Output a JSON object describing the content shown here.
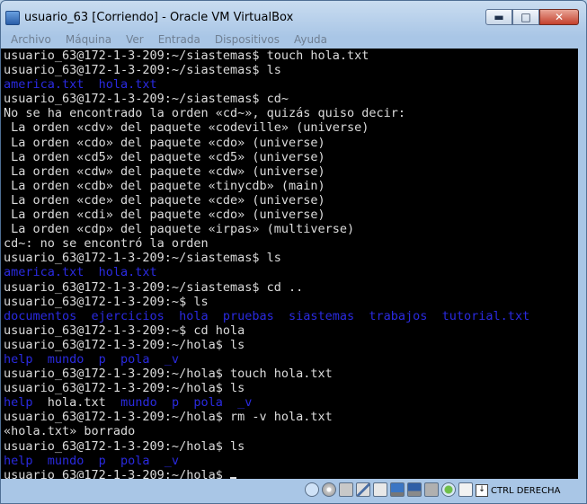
{
  "window": {
    "title": "usuario_63 [Corriendo] - Oracle VM VirtualBox"
  },
  "window_buttons": {
    "minimize": "▬",
    "maximize": "□",
    "close": "✕"
  },
  "menu": [
    "Archivo",
    "Máquina",
    "Ver",
    "Entrada",
    "Dispositivos",
    "Ayuda"
  ],
  "terminal": {
    "lines": [
      {
        "text": "usuario_63@172-1-3-209:~/siastemas$ touch hola.txt",
        "style": "normal"
      },
      {
        "text": "usuario_63@172-1-3-209:~/siastemas$ ls",
        "style": "normal"
      },
      {
        "text": "america.txt  hola.txt",
        "style": "blue"
      },
      {
        "text": "usuario_63@172-1-3-209:~/siastemas$ cd~",
        "style": "normal"
      },
      {
        "text": "No se ha encontrado la orden «cd~», quizás quiso decir:",
        "style": "normal"
      },
      {
        "text": " La orden «cdv» del paquete «codeville» (universe)",
        "style": "normal"
      },
      {
        "text": " La orden «cdo» del paquete «cdo» (universe)",
        "style": "normal"
      },
      {
        "text": " La orden «cd5» del paquete «cd5» (universe)",
        "style": "normal"
      },
      {
        "text": " La orden «cdw» del paquete «cdw» (universe)",
        "style": "normal"
      },
      {
        "text": " La orden «cdb» del paquete «tinycdb» (main)",
        "style": "normal"
      },
      {
        "text": " La orden «cde» del paquete «cde» (universe)",
        "style": "normal"
      },
      {
        "text": " La orden «cdi» del paquete «cdo» (universe)",
        "style": "normal"
      },
      {
        "text": " La orden «cdp» del paquete «irpas» (multiverse)",
        "style": "normal"
      },
      {
        "text": "cd~: no se encontró la orden",
        "style": "normal"
      },
      {
        "text": "usuario_63@172-1-3-209:~/siastemas$ ls",
        "style": "normal"
      },
      {
        "text": "america.txt  hola.txt",
        "style": "blue"
      },
      {
        "text": "usuario_63@172-1-3-209:~/siastemas$ cd ..",
        "style": "normal"
      },
      {
        "text": "usuario_63@172-1-3-209:~$ ls",
        "style": "normal"
      },
      {
        "text": "documentos  ejercicios  hola  pruebas  siastemas  trabajos  tutorial.txt",
        "style": "blue"
      },
      {
        "text": "usuario_63@172-1-3-209:~$ cd hola",
        "style": "normal"
      },
      {
        "text": "usuario_63@172-1-3-209:~/hola$ ls",
        "style": "normal"
      },
      {
        "text": "help  mundo  p  pola  _v",
        "style": "blue"
      },
      {
        "text": "usuario_63@172-1-3-209:~/hola$ touch hola.txt",
        "style": "normal"
      },
      {
        "text": "usuario_63@172-1-3-209:~/hola$ ls",
        "style": "normal"
      },
      {
        "text": "help  hola.txt  mundo  p  pola  _v",
        "style": "mixed"
      },
      {
        "text": "usuario_63@172-1-3-209:~/hola$ rm -v hola.txt",
        "style": "normal"
      },
      {
        "text": "«hola.txt» borrado",
        "style": "normal"
      },
      {
        "text": "usuario_63@172-1-3-209:~/hola$ ls",
        "style": "normal"
      },
      {
        "text": "help  mundo  p  pola  _v",
        "style": "blue"
      },
      {
        "text": "usuario_63@172-1-3-209:~/hola$ ",
        "style": "prompt"
      }
    ]
  },
  "statusbar": {
    "host_key": "CTRL DERECHA",
    "icons": [
      "hard-disk-icon",
      "optical-drive-icon",
      "floppy-icon",
      "usb-icon",
      "shared-folders-icon",
      "display-icon",
      "network-icon",
      "video-capture-icon",
      "mouse-integration-icon",
      "host-key-icon"
    ]
  },
  "colors": {
    "terminal_bg": "#000000",
    "terminal_fg": "#dcdcdc",
    "dir_blue": "#2a2ae0"
  }
}
